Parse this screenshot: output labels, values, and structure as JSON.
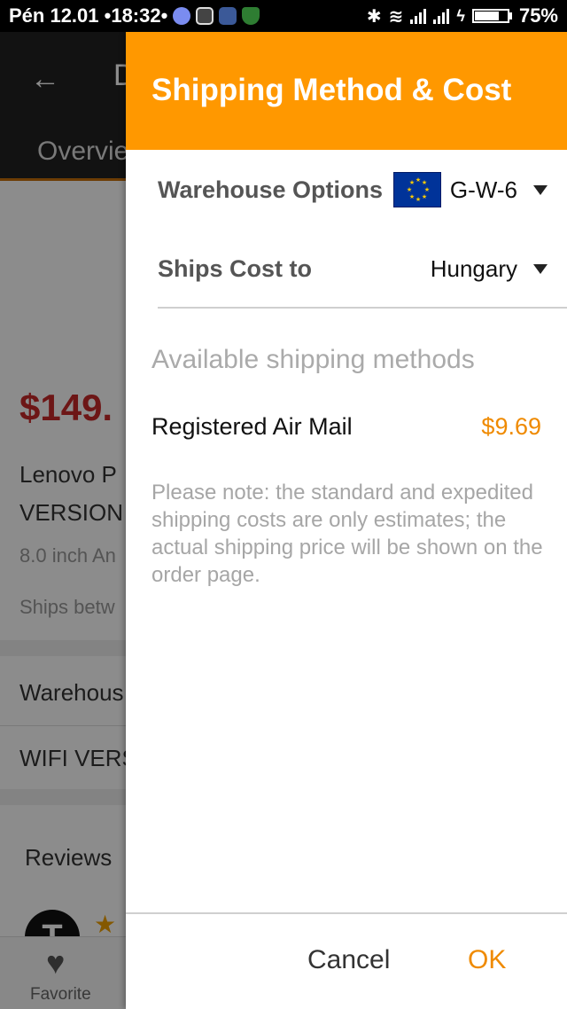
{
  "status_bar": {
    "time": "Pén 12.01 •18:32•",
    "battery": "75%",
    "battery_level": 0.75,
    "icons": [
      "messenger-icon",
      "lastpass-icon",
      "facebook-icon",
      "shield-icon",
      "bluetooth-icon",
      "wifi-icon",
      "signal-icon",
      "signal-icon",
      "charging-icon",
      "battery-icon"
    ]
  },
  "background": {
    "title_fragment": "D",
    "tab": "Overvie",
    "price": "$149.",
    "product_line1": "Lenovo P",
    "product_line2": "VERSION",
    "product_line3": "8.0 inch An",
    "ships": "Ships betw",
    "warehouse": "Warehous",
    "variant": "WIFI VERS",
    "reviews": "Reviews",
    "avatar_letter": "T",
    "favorite": "Favorite"
  },
  "dialog": {
    "title": "Shipping Method & Cost",
    "warehouse_label": "Warehouse Options",
    "warehouse_value": "G-W-6",
    "ships_to_label": "Ships Cost to",
    "ships_to_value": "Hungary",
    "available_heading": "Available shipping methods",
    "methods": [
      {
        "name": "Registered Air Mail",
        "price": "$9.69"
      }
    ],
    "note": "Please note: the standard and expedited shipping costs are only estimates; the actual shipping price will be shown on the order page.",
    "cancel": "Cancel",
    "ok": "OK"
  },
  "colors": {
    "accent": "#ff9800",
    "price": "#ef8a00",
    "eu_flag": "#003399"
  }
}
